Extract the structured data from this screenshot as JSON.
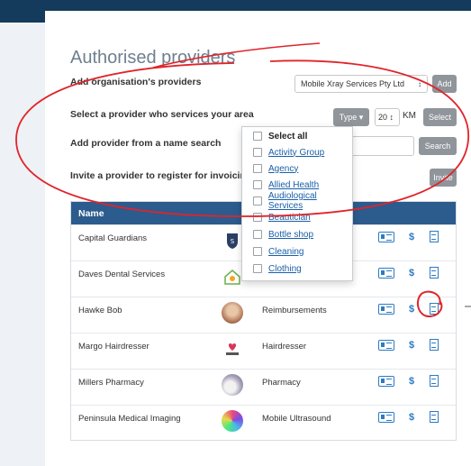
{
  "page": {
    "title": "Authorised providers"
  },
  "form": {
    "add_org_label": "Add organisation's providers",
    "org_select_value": "Mobile Xray Services Pty Ltd",
    "org_select_arrow": "↕",
    "add_button": "Add",
    "select_area_label": "Select a provider who services your area",
    "type_button": "Type ▾",
    "km_value": "20 ↕",
    "km_label": "KM",
    "select_button": "Select",
    "name_search_label": "Add provider from a name search",
    "search_button": "Search",
    "invite_label": "Invite a provider to register for invoicing",
    "invite_button": "Invite"
  },
  "dropdown": {
    "items": [
      {
        "label": "Select all"
      },
      {
        "label": "Activity Group"
      },
      {
        "label": "Agency"
      },
      {
        "label": "Allied Health"
      },
      {
        "label": "Audiological Services"
      },
      {
        "label": "Beautician"
      },
      {
        "label": "Bottle shop"
      },
      {
        "label": "Cleaning"
      },
      {
        "label": "Clothing"
      }
    ]
  },
  "table": {
    "header": "Name",
    "dollar": "$",
    "rows": [
      {
        "name": "Capital Guardians",
        "category": ""
      },
      {
        "name": "Daves Dental Services",
        "category": ""
      },
      {
        "name": "Hawke Bob",
        "category": "Reimbursements"
      },
      {
        "name": "Margo Hairdresser",
        "category": "Hairdresser"
      },
      {
        "name": "Millers Pharmacy",
        "category": "Pharmacy"
      },
      {
        "name": "Peninsula Medical Imaging",
        "category": "Mobile Ultrasound"
      }
    ]
  },
  "colors": {
    "header_bg": "#2c5b8e",
    "icon": "#2d7bc2",
    "annotation": "#e0242a"
  }
}
